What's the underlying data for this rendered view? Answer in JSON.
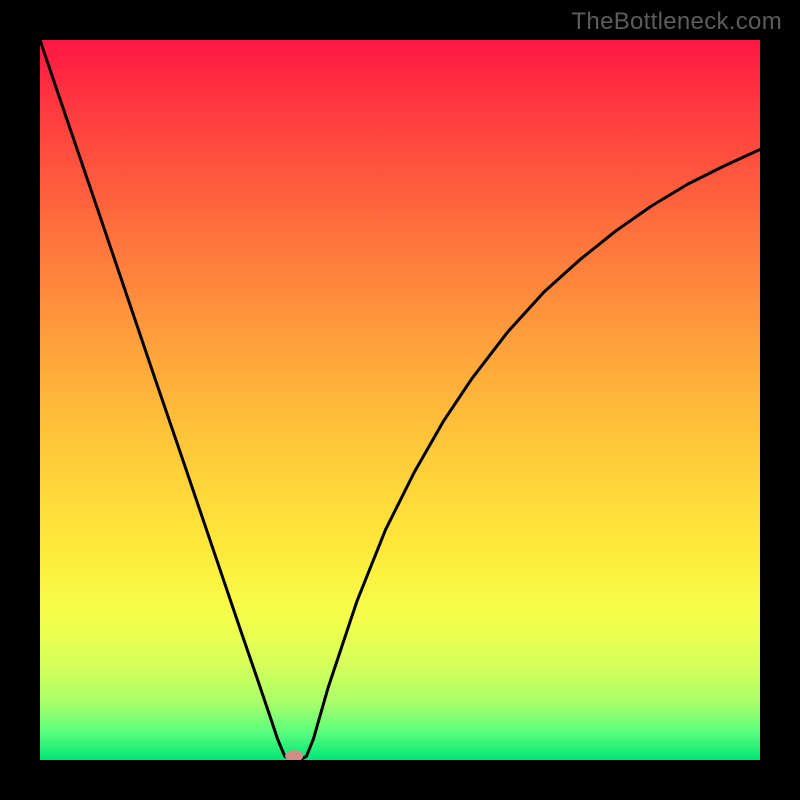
{
  "watermark": "TheBottleneck.com",
  "chart_data": {
    "type": "line",
    "title": "",
    "xlabel": "",
    "ylabel": "",
    "xlim": [
      0,
      100
    ],
    "ylim": [
      0,
      100
    ],
    "grid": false,
    "series": [
      {
        "name": "bottleneck-curve",
        "x": [
          0,
          4,
          8,
          12,
          16,
          20,
          24,
          28,
          30,
          32,
          33,
          34,
          35,
          36,
          37,
          38,
          40,
          44,
          48,
          52,
          56,
          60,
          65,
          70,
          75,
          80,
          85,
          90,
          95,
          100
        ],
        "values": [
          100,
          88.2,
          76.5,
          64.7,
          52.9,
          41.2,
          29.4,
          17.6,
          11.8,
          5.9,
          2.9,
          0.5,
          0,
          0,
          0.5,
          3,
          10,
          22,
          32,
          40,
          47,
          53,
          59.5,
          65,
          69.5,
          73.5,
          77,
          80,
          82.5,
          84.8
        ]
      }
    ],
    "marker": {
      "name": "optimal-point",
      "x": 35.3,
      "y": 0,
      "color": "#cf8d85"
    },
    "background_gradient": {
      "stops": [
        {
          "offset": 0.0,
          "color": "#ff1744"
        },
        {
          "offset": 0.1,
          "color": "#ff3b3f"
        },
        {
          "offset": 0.25,
          "color": "#ff6b3d"
        },
        {
          "offset": 0.4,
          "color": "#ff9a3c"
        },
        {
          "offset": 0.55,
          "color": "#ffc53a"
        },
        {
          "offset": 0.7,
          "color": "#ffe83a"
        },
        {
          "offset": 0.8,
          "color": "#f6ff4a"
        },
        {
          "offset": 0.87,
          "color": "#d4ff5a"
        },
        {
          "offset": 0.92,
          "color": "#a8ff6a"
        },
        {
          "offset": 0.96,
          "color": "#5dff7d"
        },
        {
          "offset": 1.0,
          "color": "#00e676"
        }
      ]
    }
  }
}
